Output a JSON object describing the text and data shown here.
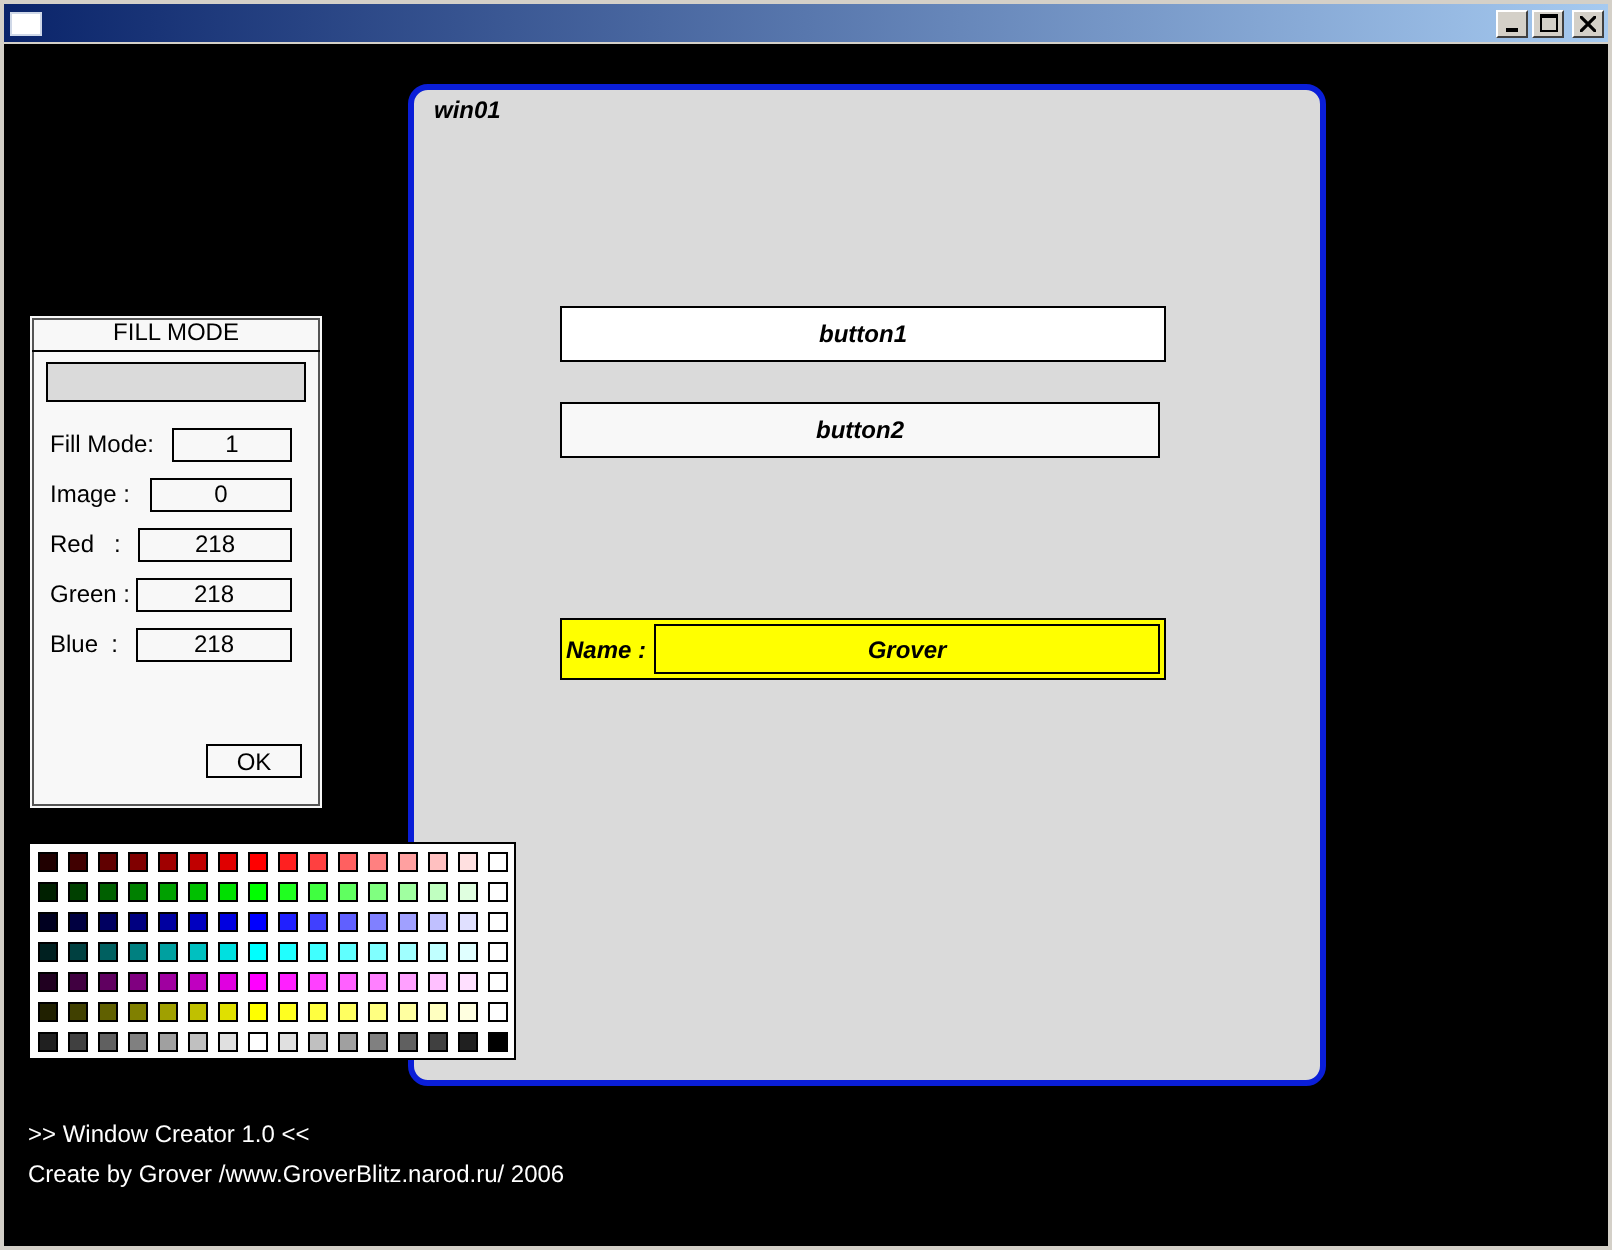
{
  "fill_panel": {
    "title": "FILL MODE",
    "fields": [
      {
        "label": "Fill Mode:",
        "value": "1"
      },
      {
        "label": "Image :",
        "value": "0"
      },
      {
        "label": "Red   :",
        "value": "218"
      },
      {
        "label": "Green :",
        "value": "218"
      },
      {
        "label": "Blue  :",
        "value": "218"
      }
    ],
    "ok_button": "OK"
  },
  "palette": [
    {
      "swatches": [
        {
          "color": "#200000"
        },
        {
          "color": "#400000"
        },
        {
          "color": "#600000"
        },
        {
          "color": "#800000"
        },
        {
          "color": "#a00000"
        },
        {
          "color": "#c00000"
        },
        {
          "color": "#e00000"
        },
        {
          "color": "#ff0000"
        },
        {
          "color": "#ff2020"
        },
        {
          "color": "#ff4040"
        },
        {
          "color": "#ff6060"
        },
        {
          "color": "#ff8080"
        },
        {
          "color": "#ffa0a0"
        },
        {
          "color": "#ffc0c0"
        },
        {
          "color": "#ffe0e0"
        },
        {
          "color": "#ffffff"
        }
      ]
    },
    {
      "swatches": [
        {
          "color": "#002000"
        },
        {
          "color": "#004000"
        },
        {
          "color": "#006000"
        },
        {
          "color": "#008000"
        },
        {
          "color": "#00a000"
        },
        {
          "color": "#00c000"
        },
        {
          "color": "#00e000"
        },
        {
          "color": "#00ff00"
        },
        {
          "color": "#20ff20"
        },
        {
          "color": "#40ff40"
        },
        {
          "color": "#60ff60"
        },
        {
          "color": "#80ff80"
        },
        {
          "color": "#a0ffa0"
        },
        {
          "color": "#c0ffc0"
        },
        {
          "color": "#e0ffe0"
        },
        {
          "color": "#ffffff"
        }
      ]
    },
    {
      "swatches": [
        {
          "color": "#000020"
        },
        {
          "color": "#000040"
        },
        {
          "color": "#000060"
        },
        {
          "color": "#000080"
        },
        {
          "color": "#0000a0"
        },
        {
          "color": "#0000c0"
        },
        {
          "color": "#0000e0"
        },
        {
          "color": "#0000ff"
        },
        {
          "color": "#2020ff"
        },
        {
          "color": "#4040ff"
        },
        {
          "color": "#6060ff"
        },
        {
          "color": "#8080ff"
        },
        {
          "color": "#a0a0ff"
        },
        {
          "color": "#c0c0ff"
        },
        {
          "color": "#e0e0ff"
        },
        {
          "color": "#ffffff"
        }
      ]
    },
    {
      "swatches": [
        {
          "color": "#002020"
        },
        {
          "color": "#004040"
        },
        {
          "color": "#006060"
        },
        {
          "color": "#008080"
        },
        {
          "color": "#00a0a0"
        },
        {
          "color": "#00c0c0"
        },
        {
          "color": "#00e0e0"
        },
        {
          "color": "#00ffff"
        },
        {
          "color": "#20ffff"
        },
        {
          "color": "#40ffff"
        },
        {
          "color": "#60ffff"
        },
        {
          "color": "#80ffff"
        },
        {
          "color": "#a0ffff"
        },
        {
          "color": "#c0ffff"
        },
        {
          "color": "#e0ffff"
        },
        {
          "color": "#ffffff"
        }
      ]
    },
    {
      "swatches": [
        {
          "color": "#200020"
        },
        {
          "color": "#400040"
        },
        {
          "color": "#600060"
        },
        {
          "color": "#800080"
        },
        {
          "color": "#a000a0"
        },
        {
          "color": "#c000c0"
        },
        {
          "color": "#e000e0"
        },
        {
          "color": "#ff00ff"
        },
        {
          "color": "#ff20ff"
        },
        {
          "color": "#ff40ff"
        },
        {
          "color": "#ff60ff"
        },
        {
          "color": "#ff80ff"
        },
        {
          "color": "#ffa0ff"
        },
        {
          "color": "#ffc0ff"
        },
        {
          "color": "#ffe0ff"
        },
        {
          "color": "#ffffff"
        }
      ]
    },
    {
      "swatches": [
        {
          "color": "#202000"
        },
        {
          "color": "#404000"
        },
        {
          "color": "#606000"
        },
        {
          "color": "#808000"
        },
        {
          "color": "#a0a000"
        },
        {
          "color": "#c0c000"
        },
        {
          "color": "#e0e000"
        },
        {
          "color": "#ffff00"
        },
        {
          "color": "#ffff20"
        },
        {
          "color": "#ffff40"
        },
        {
          "color": "#ffff60"
        },
        {
          "color": "#ffff80"
        },
        {
          "color": "#ffffa0"
        },
        {
          "color": "#ffffc0"
        },
        {
          "color": "#ffffe0"
        },
        {
          "color": "#ffffff"
        }
      ]
    },
    {
      "swatches": [
        {
          "color": "#202020"
        },
        {
          "color": "#404040"
        },
        {
          "color": "#606060"
        },
        {
          "color": "#808080"
        },
        {
          "color": "#a0a0a0"
        },
        {
          "color": "#c0c0c0"
        },
        {
          "color": "#e0e0e0"
        },
        {
          "color": "#ffffff"
        },
        {
          "color": "#e0e0e0"
        },
        {
          "color": "#c0c0c0"
        },
        {
          "color": "#a0a0a0"
        },
        {
          "color": "#808080"
        },
        {
          "color": "#606060"
        },
        {
          "color": "#404040"
        },
        {
          "color": "#202020"
        },
        {
          "color": "#000000"
        }
      ]
    }
  ],
  "design_window": {
    "title": "win01",
    "buttons": [
      {
        "label": "button1"
      },
      {
        "label": "button2"
      }
    ],
    "name_field": {
      "label": "Name :",
      "value": "Grover"
    }
  },
  "footer": [
    ">> Window Creator 1.0 <<",
    "Create by Grover /www.GroverBlitz.narod.ru/ 2006"
  ]
}
